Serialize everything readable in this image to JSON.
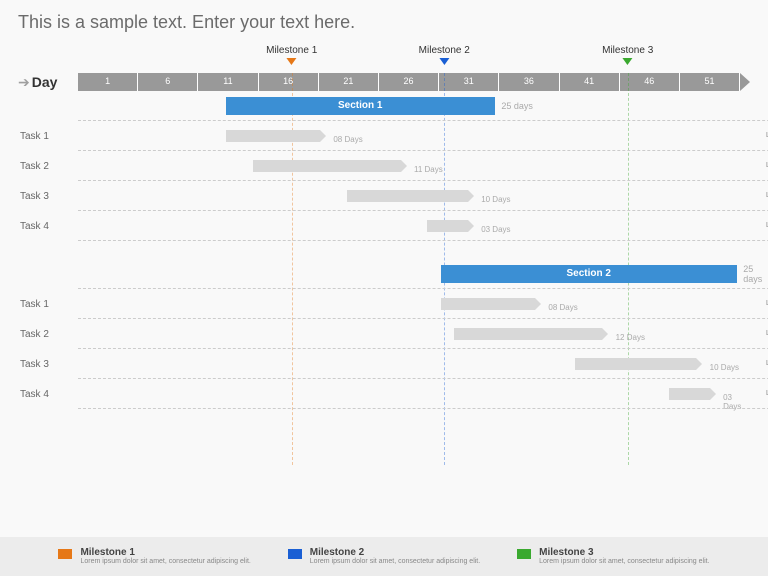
{
  "title": "This is a sample text. Enter your text here.",
  "dayLabel": "Day",
  "axisTicks": [
    "1",
    "6",
    "11",
    "16",
    "21",
    "26",
    "31",
    "36",
    "41",
    "46",
    "51"
  ],
  "milestones": [
    {
      "label": "Milestone 1",
      "pos": 31.8,
      "color": "#e67817"
    },
    {
      "label": "Milestone 2",
      "pos": 54.5,
      "color": "#1a5fd4"
    },
    {
      "label": "Milestone 3",
      "pos": 81.8,
      "color": "#3aa92f"
    }
  ],
  "sections": [
    {
      "label": "Section 1",
      "start": 22,
      "width": 40,
      "duration": "25 days",
      "tasks": [
        {
          "label": "Task 1",
          "start": 22,
          "width": 14,
          "duration": "08 Days",
          "note": "Lorem ipsum dolor sit amet"
        },
        {
          "label": "Task 2",
          "start": 26,
          "width": 22,
          "duration": "11 Days",
          "note": "Lorem ipsum dolor sit amet"
        },
        {
          "label": "Task 3",
          "start": 40,
          "width": 18,
          "duration": "10 Days",
          "note": "Lorem ipsum dolor sit amet"
        },
        {
          "label": "Task 4",
          "start": 52,
          "width": 6,
          "duration": "03 Days",
          "note": "Lorem ipsum dolor sit amet"
        }
      ]
    },
    {
      "label": "Section 2",
      "start": 54,
      "width": 44,
      "duration": "25 days",
      "tasks": [
        {
          "label": "Task 1",
          "start": 54,
          "width": 14,
          "duration": "08 Days",
          "note": "Lorem ipsum dolor sit amet"
        },
        {
          "label": "Task 2",
          "start": 56,
          "width": 22,
          "duration": "12 Days",
          "note": "Lorem ipsum dolor sit amet"
        },
        {
          "label": "Task 3",
          "start": 74,
          "width": 18,
          "duration": "10 Days",
          "note": "Lorem ipsum dolor sit amet"
        },
        {
          "label": "Task 4",
          "start": 88,
          "width": 6,
          "duration": "03 Days",
          "note": "Lorem ipsum dolor sit amet"
        }
      ]
    }
  ],
  "legend": [
    {
      "label": "Milestone 1",
      "color": "#e67817",
      "desc": "Lorem ipsum dolor sit amet, consectetur adipiscing elit."
    },
    {
      "label": "Milestone 2",
      "color": "#1a5fd4",
      "desc": "Lorem ipsum dolor sit amet, consectetur adipiscing elit."
    },
    {
      "label": "Milestone 3",
      "color": "#3aa92f",
      "desc": "Lorem ipsum dolor sit amet, consectetur adipiscing elit."
    }
  ]
}
